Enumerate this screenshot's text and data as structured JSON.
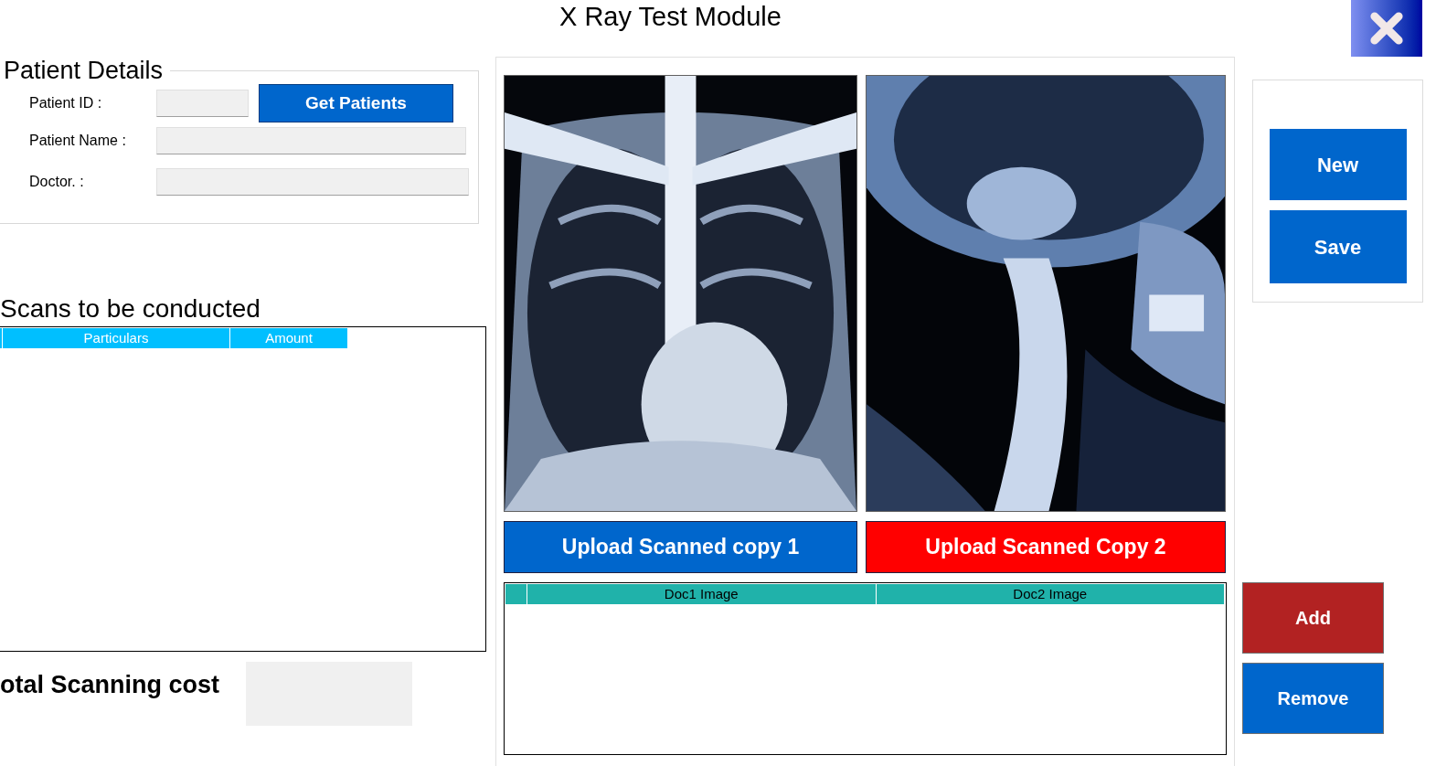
{
  "window": {
    "title": "X Ray Test Module"
  },
  "patient_details": {
    "title": "Patient Details",
    "fields": [
      {
        "label": "Patient ID :",
        "kind": "short"
      },
      {
        "label": "Patient Name :",
        "kind": "wide"
      },
      {
        "label": "Doctor. :",
        "kind": "wide"
      }
    ],
    "get_button": "Get Patients"
  },
  "scans": {
    "title": "Scans to be conducted",
    "columns": [
      "Particulars",
      "Amount"
    ],
    "total_label": "otal Scanning cost"
  },
  "upload_buttons": [
    {
      "label": "Upload Scanned copy 1",
      "color": "#0066cc"
    },
    {
      "label": "Upload Scanned Copy 2",
      "color": "#ff0000"
    }
  ],
  "docs_table": {
    "columns": [
      "Doc1 Image",
      "Doc2 Image"
    ]
  },
  "side_buttons": [
    {
      "label": "New",
      "color": "#0066cc"
    },
    {
      "label": "Save",
      "color": "#0066cc"
    }
  ],
  "action_buttons": [
    {
      "label": "Add",
      "color": "#b22222"
    },
    {
      "label": "Remove",
      "color": "#0066cc"
    }
  ]
}
